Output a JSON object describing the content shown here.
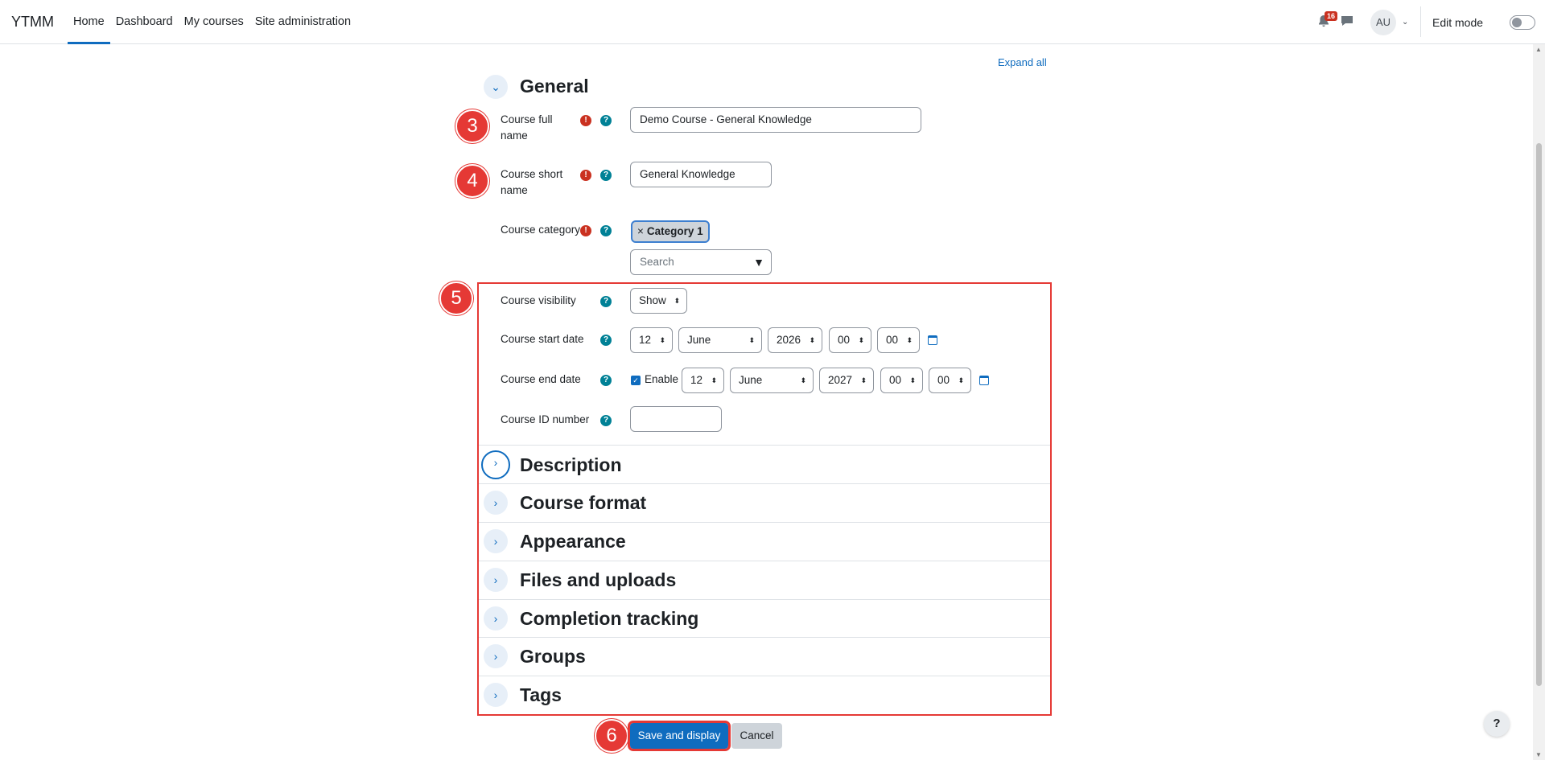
{
  "navbar": {
    "brand": "YTMM",
    "links": [
      "Home",
      "Dashboard",
      "My courses",
      "Site administration"
    ],
    "notification_count": "16",
    "avatar_initials": "AU",
    "edit_mode_label": "Edit mode"
  },
  "expand_all": "Expand all",
  "general": {
    "title": "General",
    "full_name_label": "Course full\nname",
    "full_name_value": "Demo Course - General Knowledge",
    "short_name_label": "Course short\nname",
    "short_name_value": "General Knowledge",
    "category_label": "Course category",
    "category_tag": "Category 1",
    "category_search_placeholder": "Search",
    "visibility_label": "Course visibility",
    "visibility_value": "Show",
    "start_date_label": "Course start date",
    "start_day": "12",
    "start_month": "June",
    "start_year": "2026",
    "start_hour": "00",
    "start_minute": "00",
    "end_date_label": "Course end date",
    "end_enable_label": "Enable",
    "end_day": "12",
    "end_month": "June",
    "end_year": "2027",
    "end_hour": "00",
    "end_minute": "00",
    "id_number_label": "Course ID number",
    "id_number_value": ""
  },
  "sections": [
    "Description",
    "Course format",
    "Appearance",
    "Files and uploads",
    "Completion tracking",
    "Groups",
    "Tags"
  ],
  "markers": [
    "3",
    "4",
    "5",
    "6"
  ],
  "buttons": {
    "save": "Save and display",
    "cancel": "Cancel"
  },
  "help_fab": "?",
  "colors": {
    "primary": "#0f6cbf",
    "required": "#ca3120",
    "help": "#008196",
    "annotation": "#e53935"
  }
}
